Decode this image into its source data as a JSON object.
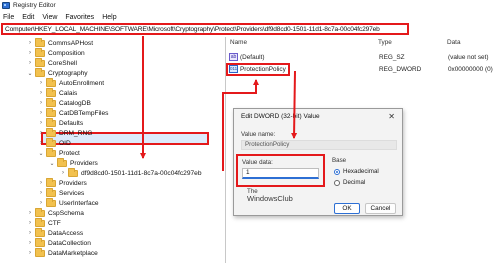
{
  "window": {
    "title": "Registry Editor"
  },
  "menu": [
    "File",
    "Edit",
    "View",
    "Favorites",
    "Help"
  ],
  "address": "Computer\\HKEY_LOCAL_MACHINE\\SOFTWARE\\Microsoft\\Cryptography\\Protect\\Providers\\df9d8cd0-1501-11d1-8c7a-00c04fc297eb",
  "tree": [
    {
      "label": "CommsAPHost",
      "indent": 2,
      "expanded": false
    },
    {
      "label": "Composition",
      "indent": 2,
      "expanded": false
    },
    {
      "label": "CoreShell",
      "indent": 2,
      "expanded": false
    },
    {
      "label": "Cryptography",
      "indent": 2,
      "expanded": true
    },
    {
      "label": "AutoEnrollment",
      "indent": 3,
      "expanded": false
    },
    {
      "label": "Calais",
      "indent": 3,
      "expanded": false
    },
    {
      "label": "CatalogDB",
      "indent": 3,
      "expanded": false
    },
    {
      "label": "CatDBTempFiles",
      "indent": 3,
      "expanded": false
    },
    {
      "label": "Defaults",
      "indent": 3,
      "expanded": false
    },
    {
      "label": "DRM_RNG",
      "indent": 3,
      "expanded": false
    },
    {
      "label": "OID",
      "indent": 3,
      "expanded": false
    },
    {
      "label": "Protect",
      "indent": 3,
      "expanded": true
    },
    {
      "label": "Providers",
      "indent": 4,
      "expanded": true
    },
    {
      "label": "df9d8cd0-1501-11d1-8c7a-00c04fc297eb",
      "indent": 5,
      "expanded": false
    },
    {
      "label": "Providers",
      "indent": 3,
      "expanded": false
    },
    {
      "label": "Services",
      "indent": 3,
      "expanded": false
    },
    {
      "label": "UserInterface",
      "indent": 3,
      "expanded": false
    },
    {
      "label": "CspSchema",
      "indent": 2,
      "expanded": false
    },
    {
      "label": "CTF",
      "indent": 2,
      "expanded": false
    },
    {
      "label": "DataAccess",
      "indent": 2,
      "expanded": false
    },
    {
      "label": "DataCollection",
      "indent": 2,
      "expanded": false
    },
    {
      "label": "DataMarketplace",
      "indent": 2,
      "expanded": false
    }
  ],
  "list": {
    "headers": {
      "name": "Name",
      "type": "Type",
      "data": "Data"
    },
    "rows": [
      {
        "name": "(Default)",
        "type": "REG_SZ",
        "data": "(value not set)",
        "icon": "ab"
      },
      {
        "name": "ProtectionPolicy",
        "type": "REG_DWORD",
        "data": "0x00000000 (0)",
        "icon": "dword"
      }
    ]
  },
  "dialog": {
    "title": "Edit DWORD (32-bit) Value",
    "close": "✕",
    "value_name_label": "Value name:",
    "value_name": "ProtectionPolicy",
    "value_data_label": "Value data:",
    "value_data": "1",
    "base_label": "Base",
    "hex_label": "Hexadecimal",
    "dec_label": "Decimal",
    "base_selected": "hex",
    "ok": "OK",
    "cancel": "Cancel"
  },
  "watermark": {
    "line1": "The",
    "line2": "WindowsClub"
  },
  "colors": {
    "highlight": "#e4191b",
    "accent": "#2d6fd4",
    "folder": "#f2c14e"
  }
}
